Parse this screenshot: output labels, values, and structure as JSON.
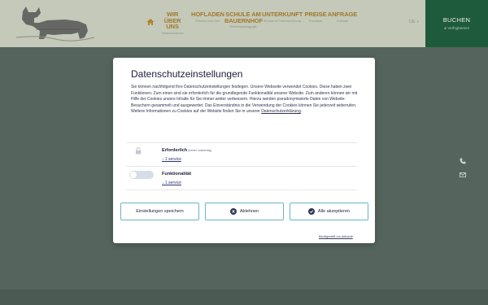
{
  "header": {
    "nav": [
      {
        "title_lines": [
          "WIR",
          "ÜBER",
          "UNS"
        ],
        "sub": "Wissenswertes"
      },
      {
        "title_lines": [
          "HOFLADEN"
        ],
        "sub": "Frische vom Hof"
      },
      {
        "title_lines": [
          "SCHULE AM",
          "BAUERNHOF"
        ],
        "sub": "Erlebnispädagogik"
      },
      {
        "title_lines": [
          "UNTERKUNFT"
        ],
        "sub": "Zimmer & Ferienwohnung"
      },
      {
        "title_lines": [
          "PREISE"
        ],
        "sub": "Preisliste"
      },
      {
        "title_lines": [
          "ANFRAGE"
        ],
        "sub": "Kontakt"
      }
    ],
    "language": "DE",
    "booking": {
      "title": "BUCHEN",
      "sub": "& Verfügbarkeit"
    }
  },
  "modal": {
    "title": "Datenschutzeinstellungen",
    "intro": "Sie können nachfolgend Ihre Datenschutzeinstellungen festlegen. Unsere Webseite verwendet Cookies. Diese haben zwei Funktionen: Zum einen sind sie erforderlich für die grundlegende Funktionalität unserer Website. Zum anderen können wir mit Hilfe der Cookies unsere Inhalte für Sie immer weiter verbessern. Hierzu werden pseudonymisierte Daten von Website-Besuchern gesammelt und ausgewertet. Das Einverständnis in die Verwendung der Cookies können Sie jederzeit widerrufen. Weitere Informationen zu Cookies auf der Website finden Sie in unserer",
    "privacy_link": "Datenschutzerklärung",
    "categories": [
      {
        "title": "Erforderlich",
        "hint": "(immer notwendig)",
        "services": "↓ 1 service",
        "enabled": true,
        "locked": true
      },
      {
        "title": "Funktionalität",
        "hint": "",
        "services": "↓ 1 service",
        "enabled": false,
        "locked": false
      }
    ],
    "buttons": {
      "save": "Einstellungen speichern",
      "reject": "Ablehnen",
      "accept_all": "Alle akzeptieren"
    },
    "powered_by": "Bereitgestellt von websedit"
  },
  "colors": {
    "brand_green": "#1e5b3c",
    "nav_gold": "#a07a2c",
    "button_border": "#6ab5c4",
    "overlay": "#55655d"
  }
}
